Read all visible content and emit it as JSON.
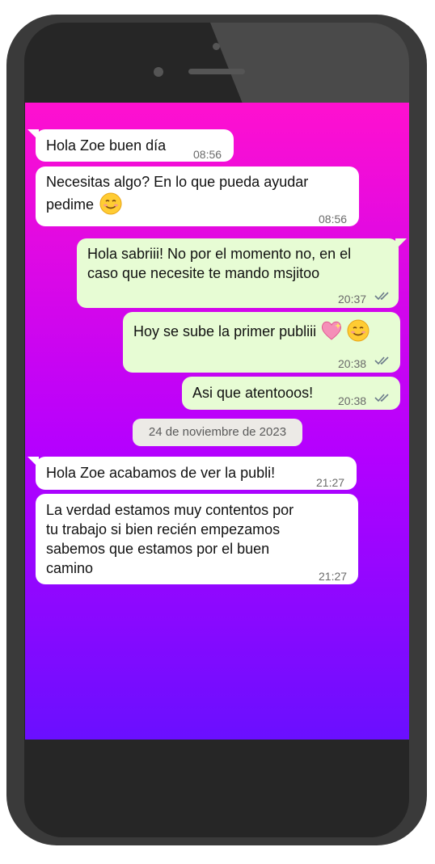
{
  "chat": {
    "messages": [
      {
        "direction": "in",
        "lines": [
          "Hola Zoe buen día"
        ],
        "time": "08:56"
      },
      {
        "direction": "in",
        "lines": [
          "Necesitas algo? En lo que pueda ayudar",
          "pedime"
        ],
        "time": "08:56"
      },
      {
        "direction": "out",
        "lines": [
          "Hola sabriii! No por el momento no, en el",
          "caso que necesite te mando msjitoo"
        ],
        "time": "20:37"
      },
      {
        "direction": "out",
        "lines": [
          "Hoy se sube la primer publiii"
        ],
        "time": "20:38"
      },
      {
        "direction": "out",
        "lines": [
          "Asi que atentooos!"
        ],
        "time": "20:38"
      },
      {
        "direction": "in",
        "lines": [
          "Hola Zoe acabamos de ver la publi!"
        ],
        "time": "21:27"
      },
      {
        "direction": "in",
        "lines": [
          "La verdad estamos muy contentos por",
          "tu trabajo si bien recién empezamos",
          "sabemos que estamos por el buen",
          "camino"
        ],
        "time": "21:27"
      }
    ],
    "date_separator": "24 de noviembre de 2023"
  },
  "colors": {
    "incoming_bubble": "#ffffff",
    "outgoing_bubble": "#e7fcd4",
    "screen_top": "#ff10cf",
    "screen_bottom": "#6a0fff",
    "phone_frame": "#3a3a3a",
    "read_ticks": "#6b7a8a"
  },
  "icons": [
    "smiling-face-emoji",
    "sparkling-heart-emoji",
    "double-check-icon"
  ]
}
